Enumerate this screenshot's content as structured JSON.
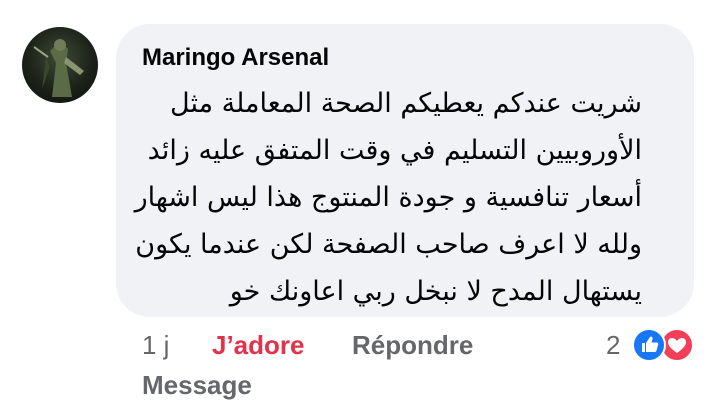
{
  "comment": {
    "author": "Maringo Arsenal",
    "lines": [
      "شريت عندكم يعطيكم الصحة المعاملة مثل",
      "الأوروبيين التسليم في وقت المتفق عليه زائد",
      "أسعار تنافسية و جودة المنتوج هذا ليس اشهار",
      "ولله لا اعرف صاحب الصفحة لكن عندما يكون",
      "يستهال المدح لا نبخل ربي اعاونك خو"
    ]
  },
  "actions": {
    "time": "1 j",
    "react_label": "J’adore",
    "reply_label": "Répondre",
    "message_label": "Message"
  },
  "reactions": {
    "count": "2",
    "icons": [
      "like-icon",
      "love-icon"
    ],
    "colors": {
      "like": "#1877f2",
      "love": "#f33e58",
      "active_reaction": "#e4314c"
    }
  }
}
